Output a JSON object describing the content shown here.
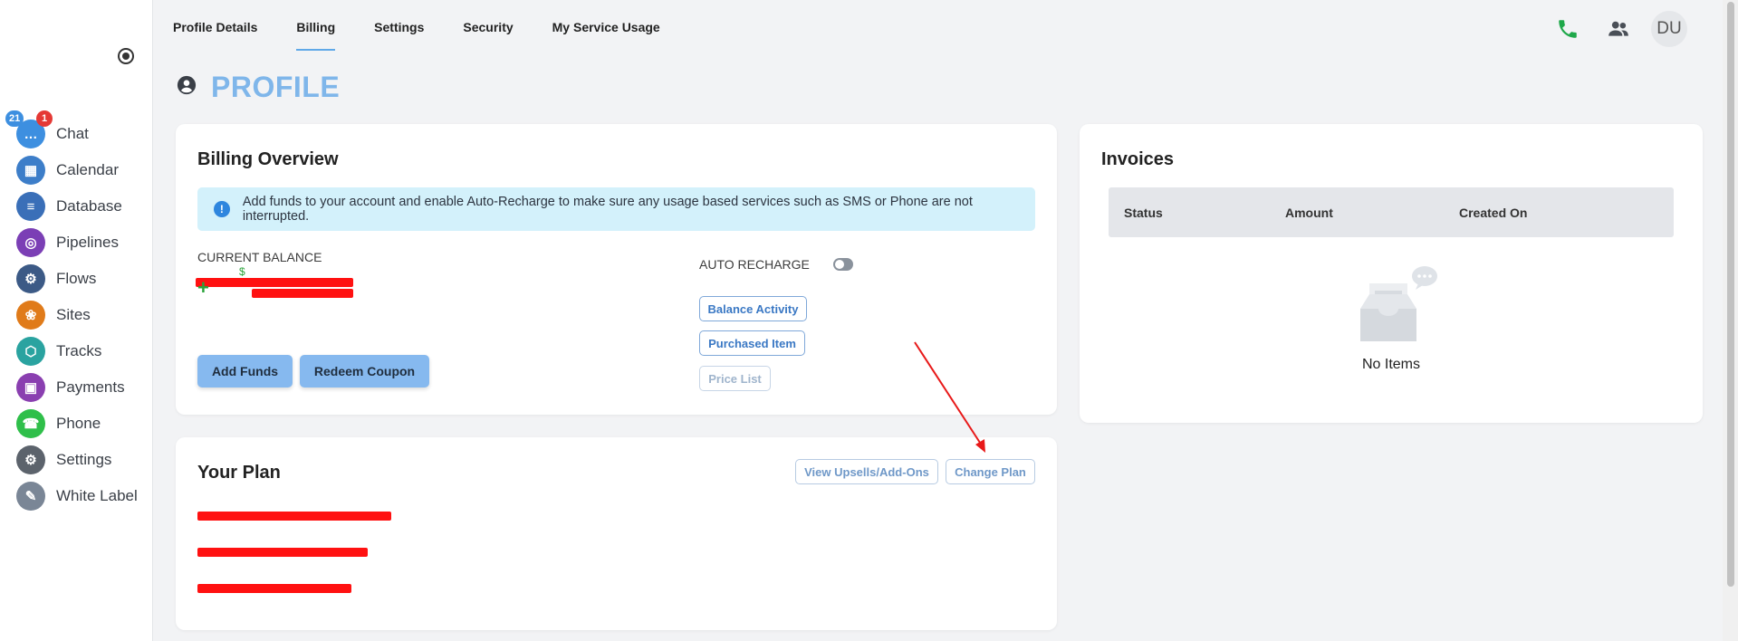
{
  "sidebar": {
    "items": [
      {
        "label": "Chat",
        "icon": "chat-icon",
        "color": "#3d8fe0"
      },
      {
        "label": "Calendar",
        "icon": "calendar-icon",
        "color": "#3d7ec9"
      },
      {
        "label": "Database",
        "icon": "database-icon",
        "color": "#3a6fb8"
      },
      {
        "label": "Pipelines",
        "icon": "pipelines-icon",
        "color": "#7b3fb5"
      },
      {
        "label": "Flows",
        "icon": "flows-icon",
        "color": "#3c5a86"
      },
      {
        "label": "Sites",
        "icon": "sites-icon",
        "color": "#e07b1a"
      },
      {
        "label": "Tracks",
        "icon": "tracks-icon",
        "color": "#2aa3a0"
      },
      {
        "label": "Payments",
        "icon": "payments-icon",
        "color": "#8a3fb0"
      },
      {
        "label": "Phone",
        "icon": "phone-icon",
        "color": "#2fbf4a"
      },
      {
        "label": "Settings",
        "icon": "settings-icon",
        "color": "#5c636c"
      },
      {
        "label": "White Label",
        "icon": "white-label-icon",
        "color": "#7a8696"
      }
    ],
    "chat_badge_blue": "21",
    "chat_badge_red": "1"
  },
  "tabs": [
    {
      "label": "Profile Details"
    },
    {
      "label": "Billing",
      "active": true
    },
    {
      "label": "Settings"
    },
    {
      "label": "Security"
    },
    {
      "label": "My Service Usage"
    }
  ],
  "header": {
    "avatar_initials": "DU"
  },
  "page": {
    "title": "PROFILE"
  },
  "billing": {
    "title": "Billing Overview",
    "banner": "Add funds to your account and enable Auto-Recharge to make sure any usage based services such as SMS or Phone are not interrupted.",
    "current_balance_label": "CURRENT BALANCE",
    "auto_recharge_label": "AUTO RECHARGE",
    "add_funds": "Add Funds",
    "redeem_coupon": "Redeem Coupon",
    "balance_activity": "Balance Activity",
    "purchased_item": "Purchased Item",
    "price_list": "Price List"
  },
  "plan": {
    "title": "Your Plan",
    "view_upsells": "View Upsells/Add-Ons",
    "change_plan": "Change Plan"
  },
  "invoices": {
    "title": "Invoices",
    "columns": [
      "Status",
      "Amount",
      "Created On"
    ],
    "empty_text": "No Items"
  },
  "colors": {
    "accent": "#7fb6ea",
    "annotation_arrow": "#e81919",
    "redaction": "#ff1111"
  }
}
